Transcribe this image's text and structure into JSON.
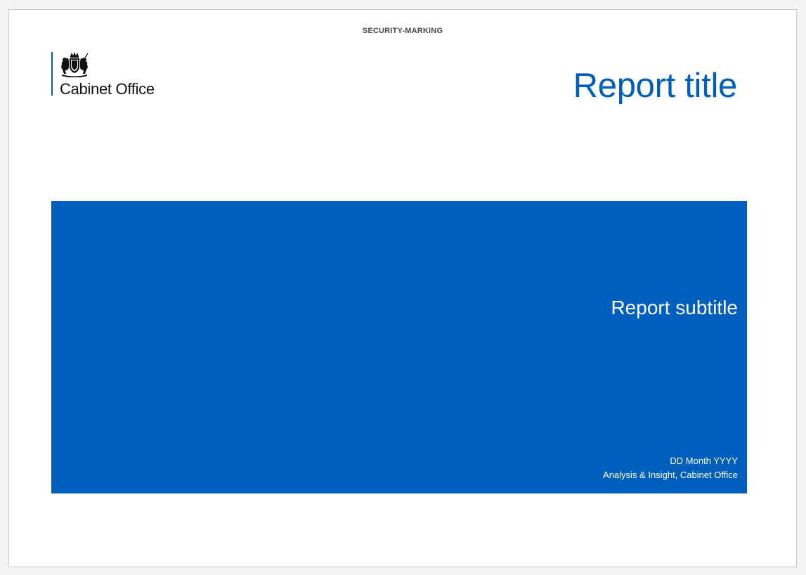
{
  "header": {
    "security_marking": "SECURITY-MARKING"
  },
  "logo": {
    "organisation": "Cabinet Office",
    "icon": "royal-crest-icon"
  },
  "report": {
    "title": "Report title",
    "subtitle": "Report subtitle",
    "date": "DD Month YYYY",
    "author": "Analysis & Insight, Cabinet Office"
  },
  "colors": {
    "brand_blue": "#005ebd",
    "page_background": "#ffffff",
    "canvas_background": "#f4f4f4",
    "text_dark": "#111111"
  }
}
